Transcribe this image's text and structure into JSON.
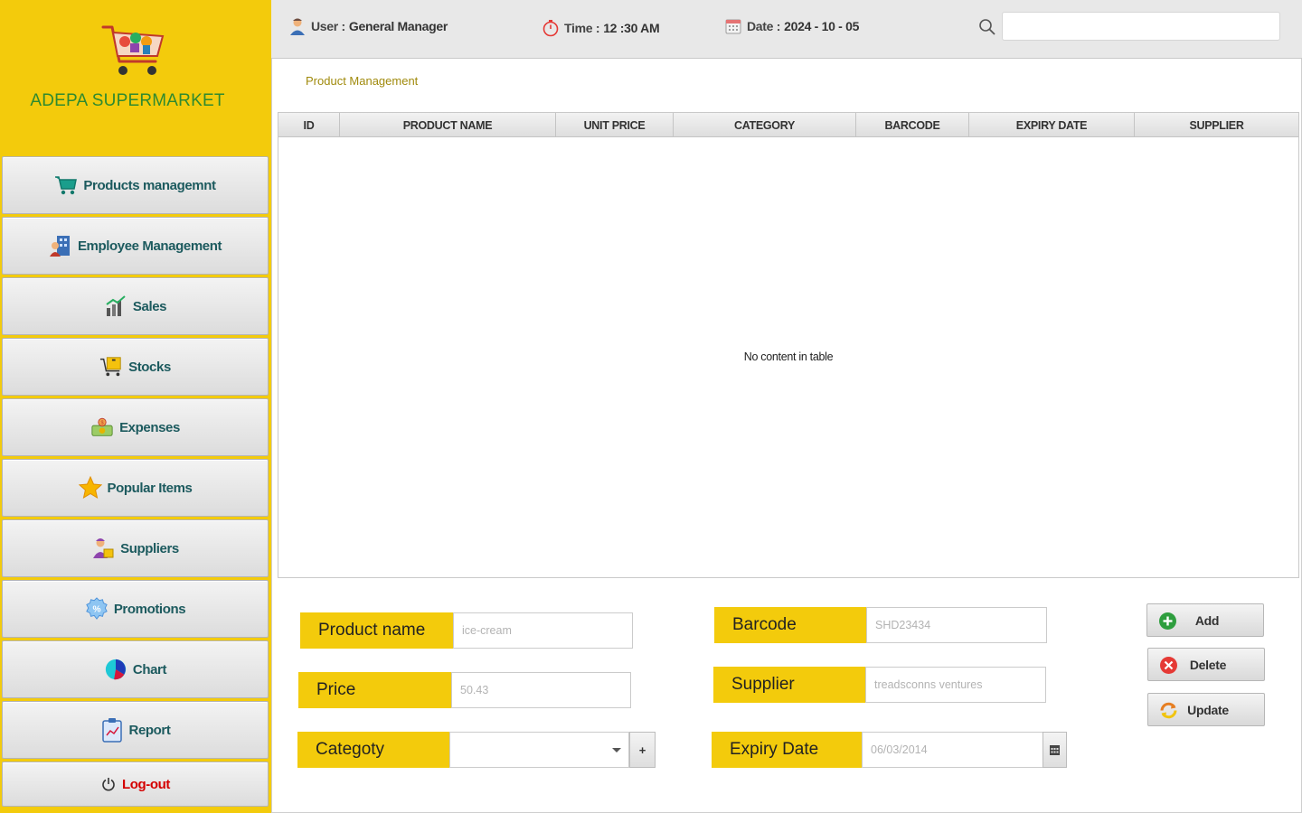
{
  "brand": {
    "name": "ADEPA SUPERMARKET",
    "logo_icon": "shopping-cart-logo"
  },
  "sidebar": {
    "items": [
      {
        "label": "Products managemnt",
        "icon": "cart-icon"
      },
      {
        "label": "Employee Management",
        "icon": "employee-icon"
      },
      {
        "label": "Sales",
        "icon": "sales-chart-icon"
      },
      {
        "label": "Stocks",
        "icon": "stock-cart-icon"
      },
      {
        "label": "Expenses",
        "icon": "money-icon"
      },
      {
        "label": "Popular Items",
        "icon": "star-icon"
      },
      {
        "label": "Suppliers",
        "icon": "supplier-icon"
      },
      {
        "label": "Promotions",
        "icon": "percent-badge-icon"
      },
      {
        "label": "Chart",
        "icon": "pie-chart-icon"
      },
      {
        "label": "Report",
        "icon": "clipboard-icon"
      },
      {
        "label": "Log-out",
        "icon": "power-icon"
      }
    ]
  },
  "topbar": {
    "user_label": "User :",
    "user_value": "General Manager",
    "time_label": "Time :",
    "time_value": "12 :30 AM",
    "date_label": "Date :",
    "date_value": "2024 - 10 - 05",
    "search_value": ""
  },
  "main": {
    "breadcrumb": "Product Management",
    "table": {
      "columns": [
        "ID",
        "PRODUCT NAME",
        "UNIT PRICE",
        "CATEGORY",
        "BARCODE",
        "EXPIRY DATE",
        "SUPPLIER"
      ],
      "rows": [],
      "empty_message": "No content in table"
    }
  },
  "form": {
    "product_name": {
      "label": "Product name",
      "placeholder": "ice-cream"
    },
    "price": {
      "label": "Price",
      "placeholder": "50.43"
    },
    "category": {
      "label": "Categoty",
      "value": "",
      "add_label": "+"
    },
    "barcode": {
      "label": "Barcode",
      "placeholder": "SHD23434"
    },
    "supplier": {
      "label": "Supplier",
      "placeholder": "treadsconns ventures"
    },
    "expiry": {
      "label": "Expiry Date",
      "placeholder": "06/03/2014"
    }
  },
  "actions": {
    "add": "Add",
    "delete": "Delete",
    "update": "Update"
  },
  "colors": {
    "sidebar_bg": "#f3cb0c",
    "brand_text": "#2f8a2f",
    "nav_text": "#1c5a5e",
    "logout_text": "#d40000",
    "breadcrumb_text": "#a08a0c"
  }
}
